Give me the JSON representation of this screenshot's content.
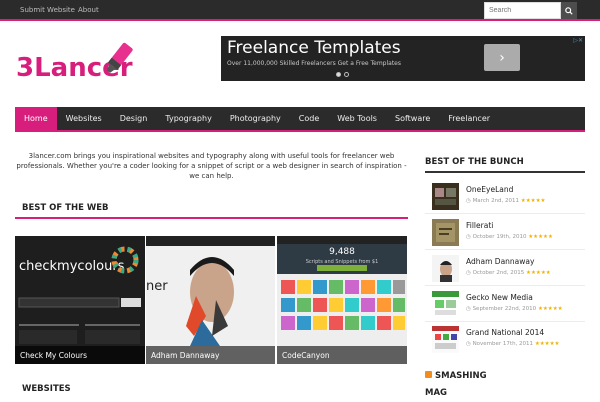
{
  "topbar": {
    "links": [
      "Submit Website",
      "About"
    ],
    "search_placeholder": "Search"
  },
  "logo": {
    "text": "3Lancer"
  },
  "ad": {
    "title": "Freelance Templates",
    "subtitle": "Over 11,000,000 Skilled Freelancers Get a Free Templates",
    "button_glyph": "›",
    "close_glyph": "▷✕"
  },
  "nav": {
    "items": [
      "Home",
      "Websites",
      "Design",
      "Typography",
      "Photography",
      "Code",
      "Web Tools",
      "Software",
      "Freelancer"
    ],
    "active": "Home"
  },
  "intro": "3lancer.com brings you inspirational websites and typography along with useful tools for freelancer web professionals. Whether you're a coder looking for a snippet of script or a web designer in search of inspiration - we can help.",
  "best_of_web": {
    "title": "BEST OF THE WEB",
    "items": [
      {
        "caption": "Check My Colours",
        "screen_text": "checkmycolours"
      },
      {
        "caption": "Adham Dannaway",
        "screen_text": "ner"
      },
      {
        "caption": "CodeCanyon",
        "screen_text": "9,488",
        "screen_sub": "Scripts and Snippets from $1"
      }
    ]
  },
  "websites": {
    "title": "WEBSITES"
  },
  "sidebar": {
    "title": "BEST OF THE BUNCH",
    "items": [
      {
        "title": "OneEyeLand",
        "date": "March 2nd, 2011",
        "stars": "★★★★★"
      },
      {
        "title": "Fillerati",
        "date": "October 19th, 2010",
        "stars": "★★★★★"
      },
      {
        "title": "Adham Dannaway",
        "date": "October 2nd, 2015",
        "stars": "★★★★★"
      },
      {
        "title": "Gecko New Media",
        "date": "September 22nd, 2010",
        "stars": "★★★★★"
      },
      {
        "title": "Grand National 2014",
        "date": "November 17th, 2011",
        "stars": "★★★★★"
      }
    ],
    "smashing_title_1": "SMASHING",
    "smashing_title_2": "MAG"
  },
  "colors": {
    "accent": "#d81e7d",
    "dark": "#2b2b2b"
  }
}
